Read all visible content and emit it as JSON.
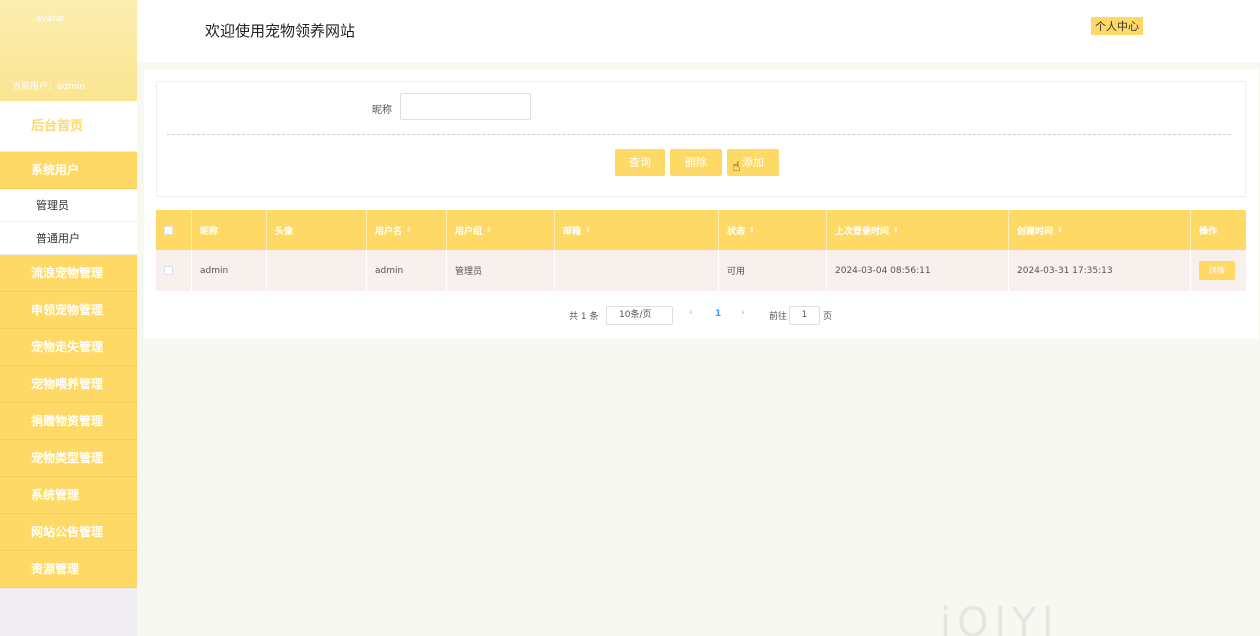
{
  "sidebar": {
    "avatar_alt": "avatar",
    "current_user": "当前用户：admin",
    "home": "后台首页",
    "items": [
      {
        "label": "系统用户"
      },
      {
        "label": "管理员"
      },
      {
        "label": "普通用户"
      },
      {
        "label": "流浪宠物管理"
      },
      {
        "label": "申领宠物管理"
      },
      {
        "label": "宠物走失管理"
      },
      {
        "label": "宠物喂养管理"
      },
      {
        "label": "捐赠物资管理"
      },
      {
        "label": "宠物类型管理"
      },
      {
        "label": "系统管理"
      },
      {
        "label": "网站公告管理"
      },
      {
        "label": "资源管理"
      }
    ]
  },
  "header": {
    "title": "欢迎使用宠物领养网站",
    "user_center": "个人中心"
  },
  "search": {
    "nickname_label": "昵称",
    "nickname_value": "",
    "query_btn": "查询",
    "delete_btn": "删除",
    "add_btn": "添加"
  },
  "table": {
    "columns": [
      "昵称",
      "头像",
      "用户名",
      "用户组",
      "邮箱",
      "状态",
      "上次登录时间",
      "创建时间",
      "操作"
    ],
    "rows": [
      {
        "nickname": "admin",
        "avatar": "",
        "username": "admin",
        "group": "管理员",
        "email": "",
        "status": "可用",
        "last_login": "2024-03-04 08:56:11",
        "created": "2024-03-31 17:35:13",
        "action": "详情"
      }
    ]
  },
  "pager": {
    "total": "共 1 条",
    "page_size": "10条/页",
    "prev": "‹",
    "current": "1",
    "next": "›",
    "goto": "前往",
    "goto_value": "1",
    "page_unit": "页"
  },
  "colors": {
    "accent": "#ffd966",
    "bg": "#f8f8f3"
  },
  "watermark": "iOlYl"
}
